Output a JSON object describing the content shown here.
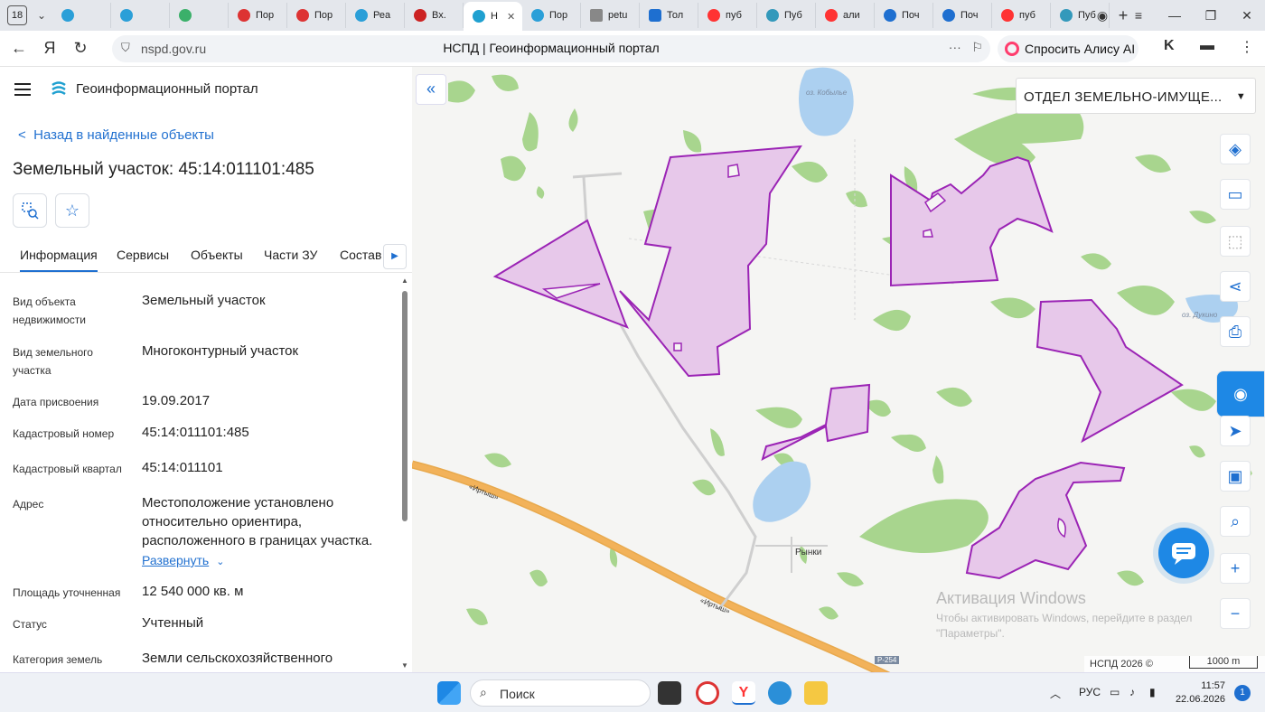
{
  "browser": {
    "tab_count": "18",
    "tabs": [
      "Пор",
      "Пор",
      "Реа",
      "Вх.",
      "Н",
      "Пор",
      "petu",
      "Тол",
      "пуб",
      "Пуб",
      "али",
      "Поч",
      "Поч",
      "пуб",
      "Пуб"
    ],
    "active_tab_index": 4,
    "url": "nspd.gov.ru",
    "page_title": "НСПД | Геоинформационный портал",
    "alice_label": "Спросить Алису AI"
  },
  "panel": {
    "portal_title": "Геоинформационный портал",
    "back_link": "Назад в найденные объекты",
    "heading": "Земельный участок: 45:14:011101:485",
    "tabs": [
      "Информация",
      "Сервисы",
      "Объекты",
      "Части ЗУ",
      "Состав"
    ],
    "active_tab": "Информация",
    "rows": [
      {
        "label": "Вид объекта недвижимости",
        "value": "Земельный участок"
      },
      {
        "label": "Вид земельного участка",
        "value": "Многоконтурный участок"
      },
      {
        "label": "Дата присвоения",
        "value": "19.09.2017"
      },
      {
        "label": "Кадастровый номер",
        "value": "45:14:011101:485"
      },
      {
        "label": "Кадастровый квартал",
        "value": "45:14:011101"
      },
      {
        "label": "Адрес",
        "value": "Местоположение установлено относительно ориентира, расположенного в границах участка."
      },
      {
        "label": "Площадь уточненная",
        "value": "12 540 000 кв. м"
      },
      {
        "label": "Статус",
        "value": "Учтенный"
      },
      {
        "label": "Категория земель",
        "value": "Земли сельскохозяйственного"
      }
    ],
    "expand_label": "Развернуть"
  },
  "map": {
    "dept_select": "ОТДЕЛ ЗЕМЕЛЬНО-ИМУЩЕ...",
    "lake_labels": [
      "оз. Кобылье",
      "оз. Дукино"
    ],
    "place_label": "Рынки",
    "road_labels": [
      "«Иртыш»",
      "«Иртыш»",
      "Р-254"
    ],
    "watermark_title": "Активация Windows",
    "watermark_text": "Чтобы активировать Windows, перейдите в раздел \"Параметры\".",
    "copyright": "НСПД 2026 ©",
    "scale_label": "1000 m",
    "parcel_color": "#e7c8ea",
    "parcel_stroke": "#9b24b5",
    "forest_color": "#a8d58e",
    "water_color": "#acd0f0",
    "road_color": "#f2b25a"
  },
  "taskbar": {
    "search_placeholder": "Поиск",
    "language": "РУС",
    "time": "11:57",
    "date": "22.06.2026",
    "notifications": "1"
  }
}
